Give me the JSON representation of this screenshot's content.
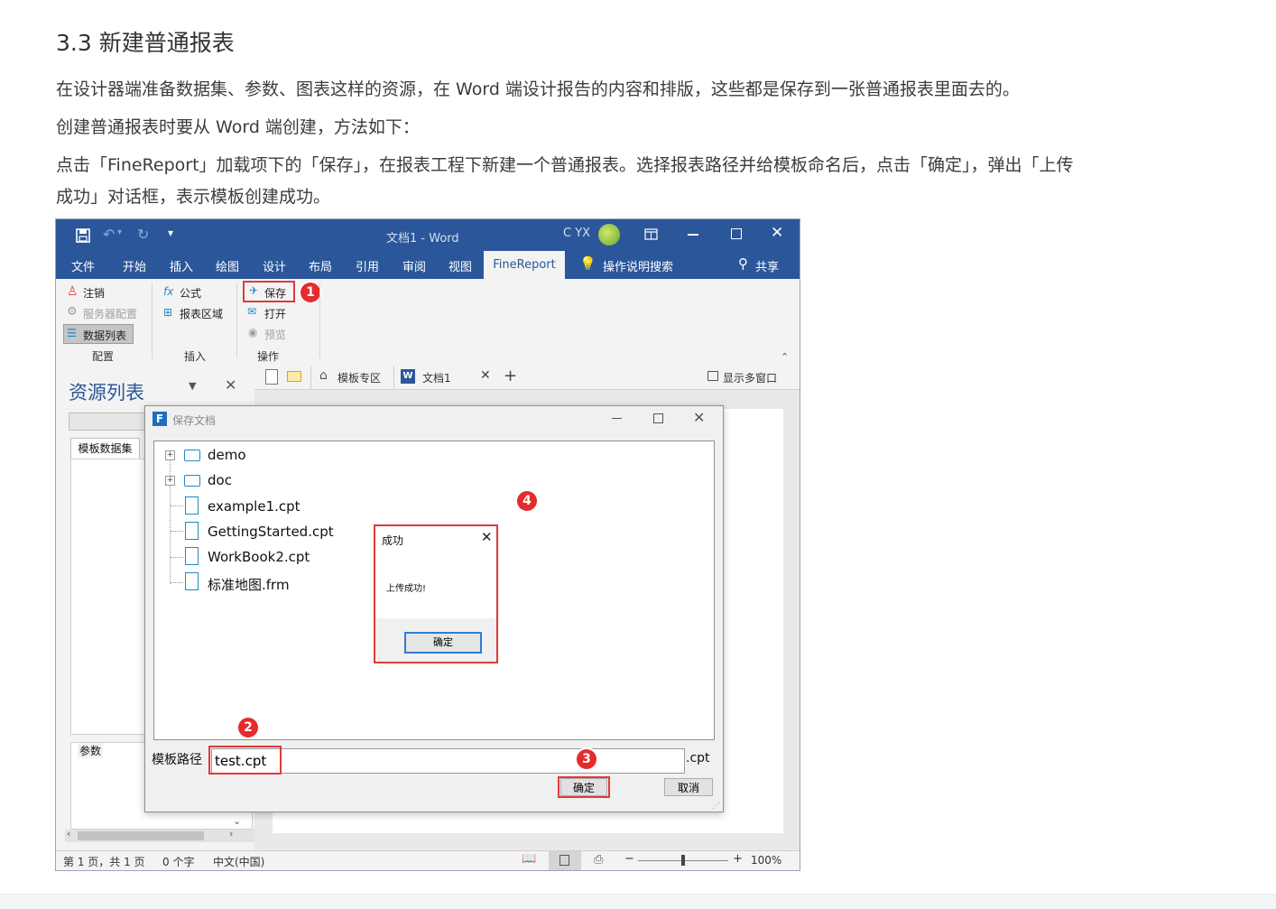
{
  "article": {
    "section_title": "3.3 新建普通报表",
    "p1": "在设计器端准备数据集、参数、图表这样的资源，在 Word 端设计报告的内容和排版，这些都是保存到一张普通报表里面去的。",
    "p2": "创建普通报表时要从 Word 端创建，方法如下：",
    "p3a": "点击「FineReport」加载项下的「保存」，在报表工程下新建一个普通报表。选择报表路径并给模板命名后，点击「确定」，弹出「上传",
    "p3b": "成功」对话框，表示模板创建成功。"
  },
  "word": {
    "window_title": "文档1 - Word",
    "user": "C YX",
    "tabs": [
      "文件",
      "开始",
      "插入",
      "绘图",
      "设计",
      "布局",
      "引用",
      "审阅",
      "视图"
    ],
    "active_tab": "FineReport",
    "tell_me": "操作说明搜索",
    "share": "共享",
    "ribbon": {
      "logout": "注销",
      "server_config": "服务器配置",
      "data_list": "数据列表",
      "group_config": "配置",
      "formula": "公式",
      "report_area": "报表区域",
      "group_insert": "插入",
      "save": "保存",
      "open": "打开",
      "preview": "预览",
      "group_operate": "操作"
    },
    "doc_tabs": {
      "template_zone": "模板专区",
      "doc1": "文档1",
      "multi_window": "显示多窗口"
    },
    "resource_panel": {
      "title": "资源列表",
      "tab_dataset": "模板数据集",
      "params": "参数"
    },
    "status": {
      "page": "第 1 页，共 1 页",
      "words": "0 个字",
      "lang": "中文(中国)",
      "zoom": "100%"
    }
  },
  "save_dialog": {
    "title": "保存文档",
    "tree": [
      {
        "name": "demo",
        "type": "folder"
      },
      {
        "name": "doc",
        "type": "folder"
      },
      {
        "name": "example1.cpt",
        "type": "file"
      },
      {
        "name": "GettingStarted.cpt",
        "type": "file"
      },
      {
        "name": "WorkBook2.cpt",
        "type": "file"
      },
      {
        "name": "标准地图.frm",
        "type": "file"
      }
    ],
    "path_label": "模板路径",
    "path_value": "test.cpt",
    "ext": ".cpt",
    "ok": "确定",
    "cancel": "取消"
  },
  "success_dialog": {
    "title": "成功",
    "message": "上传成功!",
    "ok": "确定"
  },
  "badges": [
    "1",
    "2",
    "3",
    "4"
  ],
  "colors": {
    "word_blue": "#2b579a",
    "highlight_red": "#e03a3a",
    "badge_red": "#e52b2b",
    "icon_blue": "#1e88c8"
  }
}
